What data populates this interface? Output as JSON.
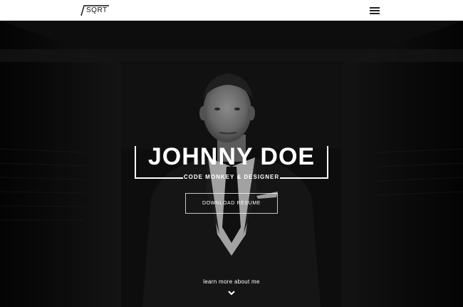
{
  "header": {
    "logo_text": "SQRT",
    "menu_icon": "hamburger-menu-icon"
  },
  "hero": {
    "title": "JOHNNY DOE",
    "subtitle": "CODE MONKEY & DESIGNER",
    "download_label": "DOWNLOAD RESUME",
    "learn_more_label": "learn more about me",
    "scroll_icon": "chevron-down-icon"
  },
  "colors": {
    "topbar": "#ffffff",
    "hero_bg": "#111111",
    "text": "#ffffff"
  }
}
